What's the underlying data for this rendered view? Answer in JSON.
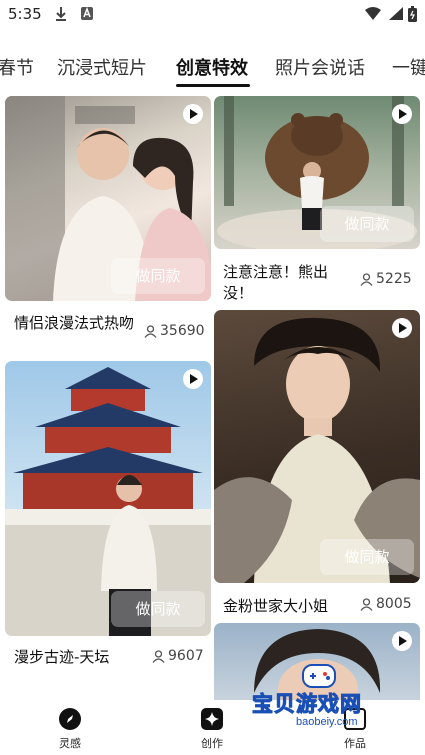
{
  "status_bar": {
    "time": "5:35"
  },
  "tabs": [
    {
      "label": "春节"
    },
    {
      "label": "沉浸式短片"
    },
    {
      "label": "创意特效"
    },
    {
      "label": "照片会说话"
    },
    {
      "label": "一键"
    }
  ],
  "active_tab_index": 2,
  "cards": [
    {
      "title": "情侣浪漫法式热吻",
      "count": "35690",
      "button": "做同款"
    },
    {
      "title": "漫步古迹-天坛",
      "count": "9607",
      "button": "做同款"
    },
    {
      "title": "注意注意！熊出没！",
      "count": "5225",
      "button": "做同款"
    },
    {
      "title": "金粉世家大小姐",
      "count": "8005",
      "button": "做同款"
    }
  ],
  "bottom_nav": [
    {
      "label": "灵感",
      "icon": "compass-icon"
    },
    {
      "label": "创作",
      "icon": "sparkle-icon"
    },
    {
      "label": "作品",
      "icon": "works-icon"
    }
  ],
  "watermark": {
    "text": "宝贝游戏网",
    "url": "baobeiy.com"
  }
}
